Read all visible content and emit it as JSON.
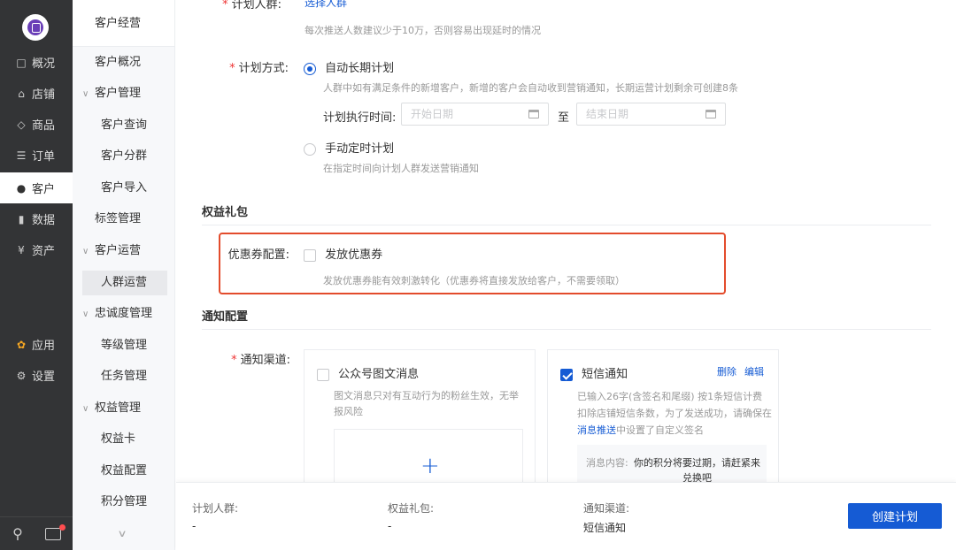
{
  "nav": {
    "items": [
      {
        "icon": "chat-icon",
        "glyph": "□",
        "label": "概况"
      },
      {
        "icon": "store-icon",
        "glyph": "⌂",
        "label": "店铺"
      },
      {
        "icon": "tag-icon",
        "glyph": "◇",
        "label": "商品"
      },
      {
        "icon": "list-icon",
        "glyph": "☰",
        "label": "订单"
      },
      {
        "icon": "user-icon",
        "glyph": "●",
        "label": "客户"
      },
      {
        "icon": "bar-chart-icon",
        "glyph": "▮",
        "label": "数据"
      },
      {
        "icon": "yen-icon",
        "glyph": "¥",
        "label": "资产"
      },
      {
        "icon": "apps-icon",
        "glyph": "✿",
        "label": "应用"
      },
      {
        "icon": "gear-icon",
        "glyph": "⚙",
        "label": "设置"
      }
    ],
    "active": "客户"
  },
  "submenu": {
    "title": "客户经营",
    "overview": "客户概况",
    "customer_mgmt": "客户管理",
    "customer_query": "客户查询",
    "customer_group": "客户分群",
    "customer_import": "客户导入",
    "tag_mgmt": "标签管理",
    "customer_ops": "客户运营",
    "crowd_ops": "人群运营",
    "loyalty_mgmt": "忠诚度管理",
    "level_mgmt": "等级管理",
    "task_mgmt": "任务管理",
    "rights_mgmt": "权益管理",
    "rights_card": "权益卡",
    "rights_config": "权益配置",
    "points_mgmt": "积分管理"
  },
  "form": {
    "crowd_label": "计划人群:",
    "crowd_link": "选择人群",
    "crowd_hint": "每次推送人数建议少于10万，否则容易出现延时的情况",
    "method_label": "计划方式:",
    "auto_plan": "自动长期计划",
    "auto_hint": "人群中如有满足条件的新增客户，新增的客户会自动收到营销通知，长期运营计划剩余可创建8条",
    "exec_time_label": "计划执行时间:",
    "start_placeholder": "开始日期",
    "to": "至",
    "end_placeholder": "结束日期",
    "manual_plan": "手动定时计划",
    "manual_hint": "在指定时间向计划人群发送营销通知",
    "rights_section": "权益礼包",
    "coupon_label": "优惠券配置:",
    "coupon_option": "发放优惠券",
    "coupon_hint": "发放优惠券能有效刺激转化（优惠券将直接发放给客户，不需要领取）",
    "notify_section": "通知配置",
    "channel_label": "通知渠道:",
    "wechat": {
      "title": "公众号图文消息",
      "desc": "图文消息只对有互动行为的粉丝生效，无举报风险"
    },
    "sms": {
      "title": "短信通知",
      "delete": "删除",
      "edit": "编辑",
      "desc_1": "已输入26字(含签名和尾缀) 按1条短信计费",
      "desc_2": "扣除店铺短信条数，为了发送成功，请确保在",
      "desc_link": "消息推送",
      "desc_3": "中设置了自定义签名",
      "content_label": "消息内容:",
      "content": "你的积分将要过期，请赶紧来兑换吧"
    }
  },
  "bottombar": {
    "crowd_label": "计划人群:",
    "crowd_value": "-",
    "rights_label": "权益礼包:",
    "rights_value": "-",
    "channel_label": "通知渠道:",
    "channel_value": "短信通知",
    "create_button": "创建计划"
  },
  "colors": {
    "primary": "#155bd4",
    "required": "#ee3333",
    "highlight_border": "#e34c2c",
    "nav_bg": "#333436"
  }
}
